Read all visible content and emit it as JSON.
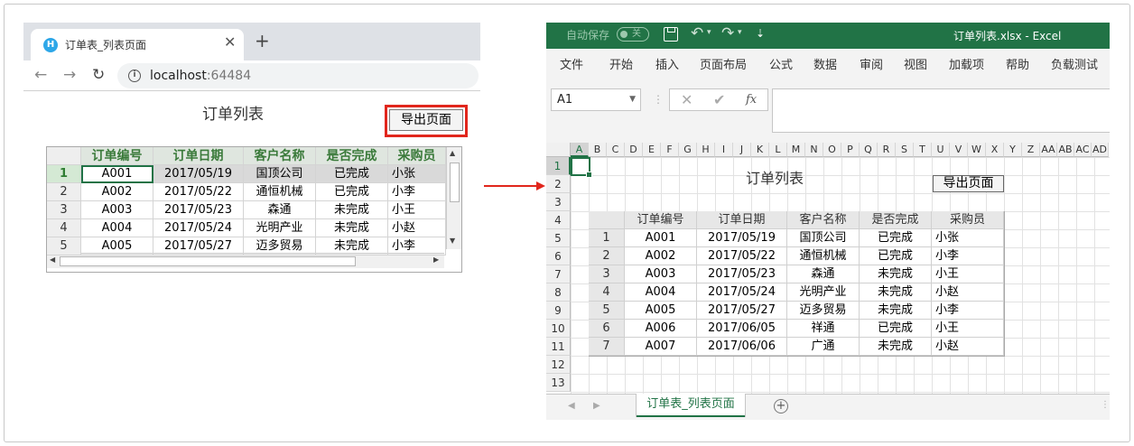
{
  "browser": {
    "tab_title": "订单表_列表页面",
    "favicon_letter": "H",
    "url_host": "localhost",
    "url_port": ":64484",
    "page_title": "订单列表",
    "export_button": "导出页面",
    "grid": {
      "columns": [
        "订单编号",
        "订单日期",
        "客户名称",
        "是否完成",
        "采购员"
      ],
      "rows": [
        {
          "n": "1",
          "cells": [
            "A001",
            "2017/05/19",
            "国顶公司",
            "已完成",
            "小张"
          ]
        },
        {
          "n": "2",
          "cells": [
            "A002",
            "2017/05/22",
            "通恒机械",
            "已完成",
            "小李"
          ]
        },
        {
          "n": "3",
          "cells": [
            "A003",
            "2017/05/23",
            "森通",
            "未完成",
            "小王"
          ]
        },
        {
          "n": "4",
          "cells": [
            "A004",
            "2017/05/24",
            "光明产业",
            "未完成",
            "小赵"
          ]
        },
        {
          "n": "5",
          "cells": [
            "A005",
            "2017/05/27",
            "迈多贸易",
            "未完成",
            "小李"
          ]
        }
      ]
    }
  },
  "excel": {
    "autosave_label": "自动保存",
    "autosave_state": "关",
    "doc_title": "订单列表.xlsx  -  Excel",
    "menu": [
      "文件",
      "开始",
      "插入",
      "页面布局",
      "公式",
      "数据",
      "审阅",
      "视图",
      "加载项",
      "帮助",
      "负载测试"
    ],
    "name_box": "A1",
    "fx_label": "fx",
    "col_headers": [
      "A",
      "B",
      "C",
      "D",
      "E",
      "F",
      "G",
      "H",
      "I",
      "J",
      "K",
      "L",
      "M",
      "N",
      "O",
      "P",
      "Q",
      "R",
      "S",
      "T",
      "U",
      "V",
      "W",
      "X",
      "Y",
      "Z",
      "AA",
      "AB",
      "AC",
      "AD"
    ],
    "row_headers": [
      "1",
      "2",
      "3",
      "4",
      "5",
      "6",
      "7",
      "8",
      "9",
      "10",
      "11",
      "12",
      "13"
    ],
    "sheet_title": "订单列表",
    "export_button": "导出页面",
    "table": {
      "columns": [
        "订单编号",
        "订单日期",
        "客户名称",
        "是否完成",
        "采购员"
      ],
      "rows": [
        {
          "n": "1",
          "cells": [
            "A001",
            "2017/05/19",
            "国顶公司",
            "已完成",
            "小张"
          ]
        },
        {
          "n": "2",
          "cells": [
            "A002",
            "2017/05/22",
            "通恒机械",
            "已完成",
            "小李"
          ]
        },
        {
          "n": "3",
          "cells": [
            "A003",
            "2017/05/23",
            "森通",
            "未完成",
            "小王"
          ]
        },
        {
          "n": "4",
          "cells": [
            "A004",
            "2017/05/24",
            "光明产业",
            "未完成",
            "小赵"
          ]
        },
        {
          "n": "5",
          "cells": [
            "A005",
            "2017/05/27",
            "迈多贸易",
            "未完成",
            "小李"
          ]
        },
        {
          "n": "6",
          "cells": [
            "A006",
            "2017/06/05",
            "祥通",
            "已完成",
            "小王"
          ]
        },
        {
          "n": "7",
          "cells": [
            "A007",
            "2017/06/06",
            "广通",
            "未完成",
            "小赵"
          ]
        }
      ]
    },
    "sheet_tab": "订单表_列表页面",
    "add_sheet": "+"
  },
  "colors": {
    "excel_green": "#217346",
    "highlight_red": "#e1261c",
    "grid_header_text": "#3a7a3a"
  }
}
